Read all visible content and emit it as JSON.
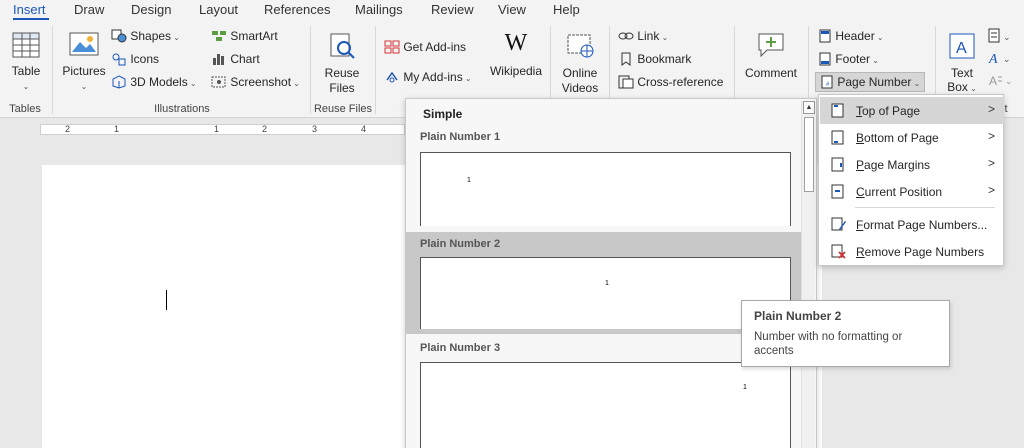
{
  "tabs": [
    "Insert",
    "Draw",
    "Design",
    "Layout",
    "References",
    "Mailings",
    "Review",
    "View",
    "Help"
  ],
  "ribbon": {
    "tables": {
      "table_label": "Table",
      "group_label": "Tables"
    },
    "illustrations": {
      "pictures_label": "Pictures",
      "shapes_label": "Shapes",
      "icons_label": "Icons",
      "models_label": "3D Models",
      "smartart_label": "SmartArt",
      "chart_label": "Chart",
      "screenshot_label": "Screenshot",
      "group_label": "Illustrations"
    },
    "reuse": {
      "line1": "Reuse",
      "line2": "Files",
      "group_label": "Reuse Files"
    },
    "addins": {
      "get_label": "Get Add-ins",
      "my_label": "My Add-ins",
      "wiki_glyph": "W",
      "wiki_label": "Wikipedia"
    },
    "media": {
      "line1": "Online",
      "line2": "Videos"
    },
    "links": {
      "link_label": "Link",
      "bookmark_label": "Bookmark",
      "crossref_label": "Cross-reference"
    },
    "comments": {
      "comment_label": "Comment"
    },
    "header_footer": {
      "header_label": "Header",
      "footer_label": "Footer",
      "page_number_label": "Page Number"
    },
    "text": {
      "textbox_line1": "Text",
      "textbox_line2": "Box",
      "group_label_fragment": "t"
    }
  },
  "ruler": {
    "numbers": [
      "2",
      "1",
      "1",
      "2",
      "3",
      "4"
    ]
  },
  "gallery": {
    "heading": "Simple",
    "items": [
      {
        "label": "Plain Number 1",
        "num": "1"
      },
      {
        "label": "Plain Number 2",
        "num": "1"
      },
      {
        "label": "Plain Number 3",
        "num": "1"
      }
    ]
  },
  "submenu": {
    "items": [
      {
        "prefix": "",
        "u": "T",
        "rest": "op of Page",
        "arrow": ">"
      },
      {
        "prefix": "",
        "u": "B",
        "rest": "ottom of Page",
        "arrow": ">"
      },
      {
        "prefix": "",
        "u": "P",
        "rest": "age Margins",
        "arrow": ">"
      },
      {
        "prefix": "",
        "u": "C",
        "rest": "urrent Position",
        "arrow": ">"
      },
      {
        "prefix": "",
        "u": "F",
        "rest": "ormat Page Numbers...",
        "arrow": ""
      },
      {
        "prefix": "",
        "u": "R",
        "rest": "emove Page Numbers",
        "arrow": ""
      }
    ]
  },
  "tooltip": {
    "title": "Plain Number 2",
    "description": "Number with no formatting or accents"
  },
  "colors": {
    "accent": "#1b57b8",
    "highlight": "#c8c8c8",
    "red": "#d13438"
  }
}
